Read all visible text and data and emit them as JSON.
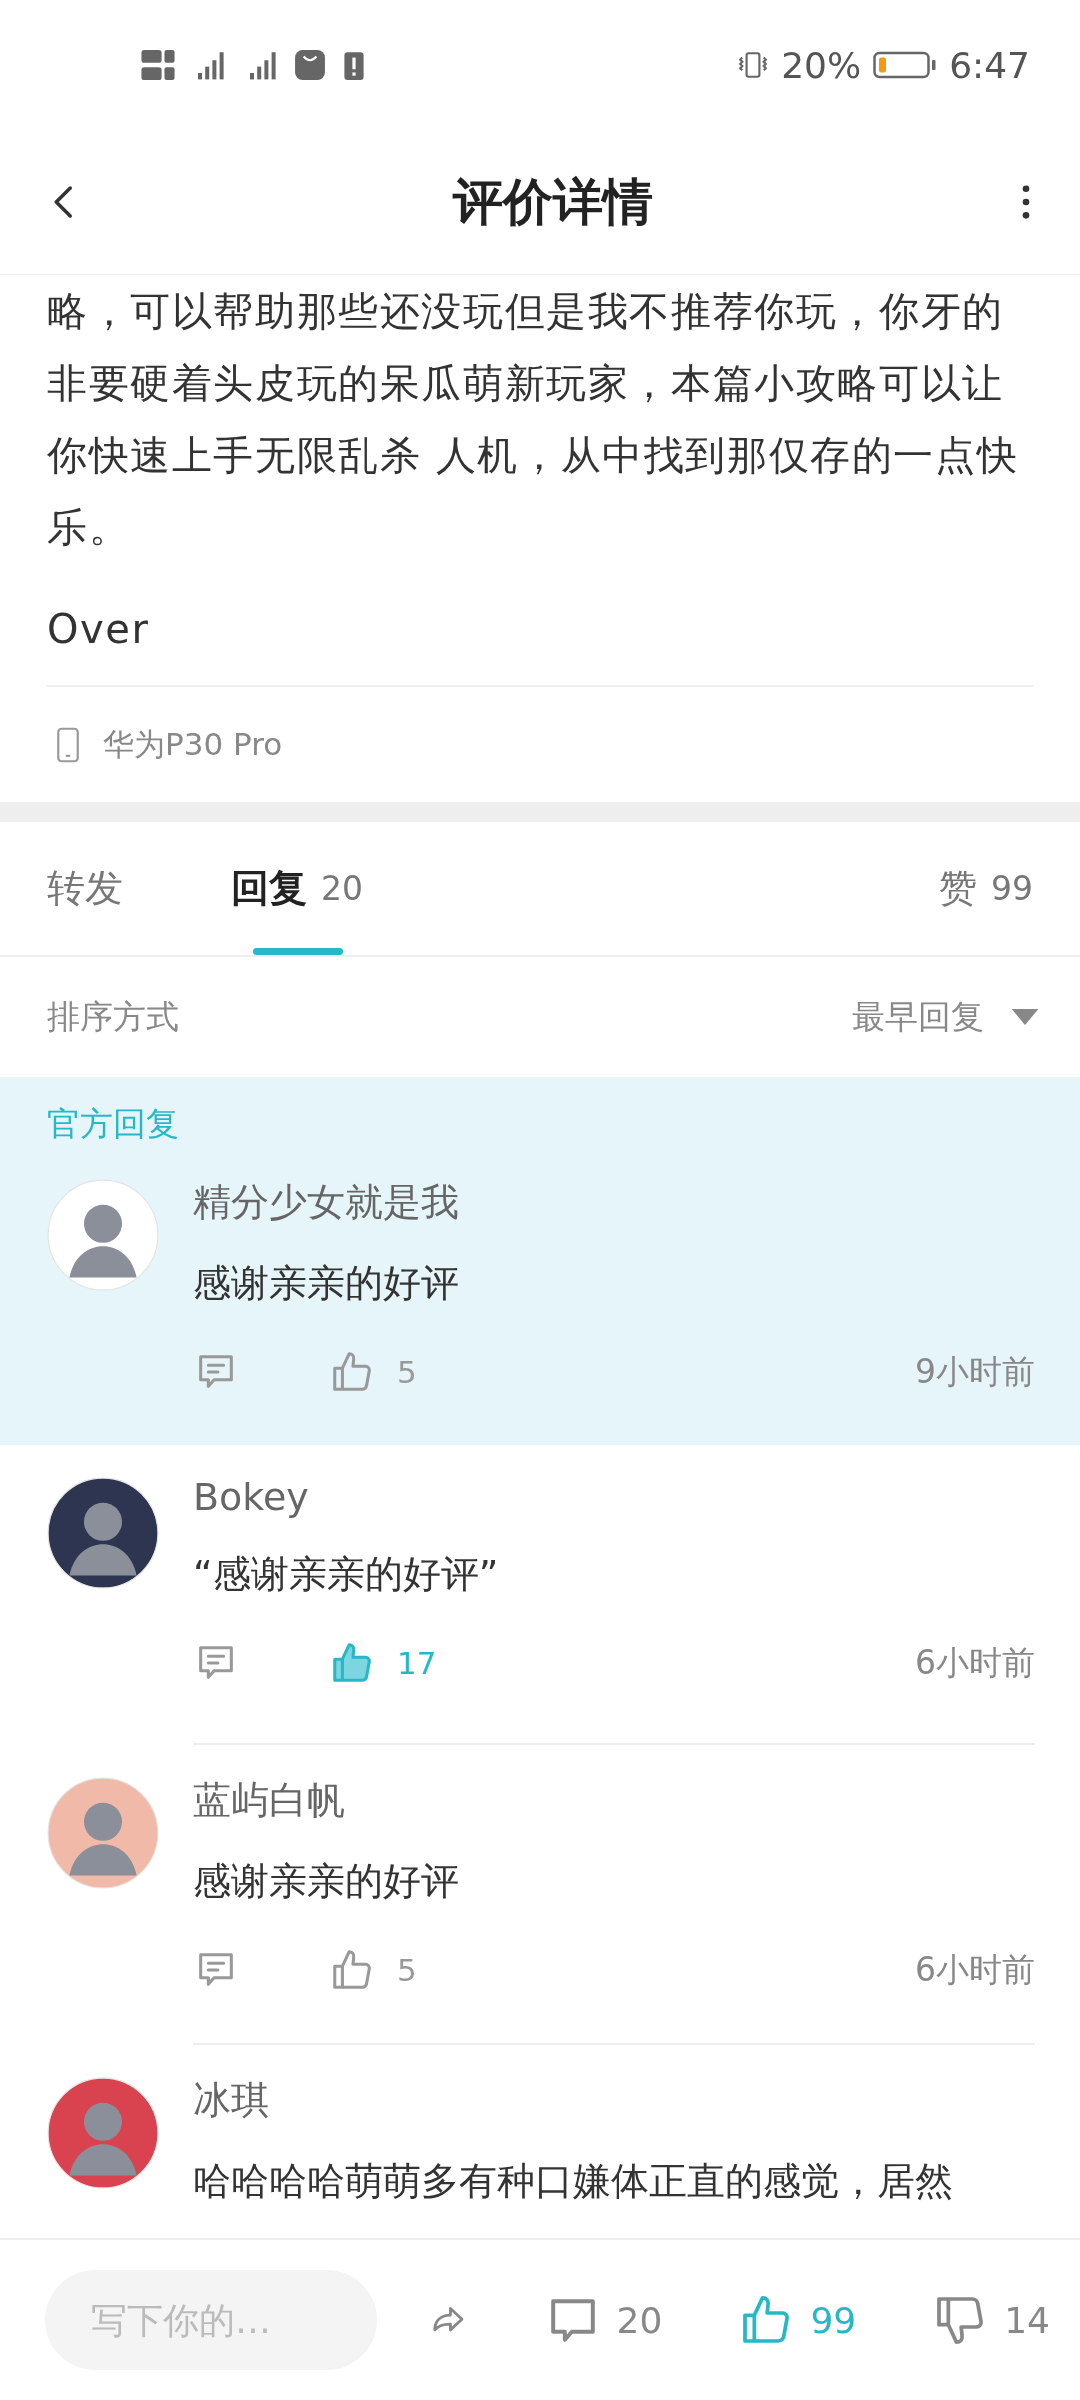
{
  "status_bar": {
    "battery": "20%",
    "time": "6:47"
  },
  "header": {
    "title": "评价详情"
  },
  "review": {
    "paragraphs": [
      "略，可以帮助那些还没玩但是我不推荐你玩，你牙的非要硬着头皮玩的呆瓜萌新玩家，本篇小攻略可以让你快速上手无限乱杀 人机，从中找到那仅存的一点快乐。",
      "Over"
    ],
    "device": "华为P30 Pro"
  },
  "tabs": [
    {
      "label": "转发",
      "selected": false
    },
    {
      "label": "回复",
      "count": "20",
      "selected": true
    },
    {
      "label": "赞",
      "count": "99",
      "selected": false
    }
  ],
  "sort": {
    "label": "排序方式",
    "value": "最早回复"
  },
  "official": {
    "label": "官方回复",
    "comments": [
      {
        "name": "精分少女就是我",
        "text": "感谢亲亲的好评",
        "likes": "5",
        "liked": false,
        "time": "9小时前"
      }
    ]
  },
  "comments": [
    {
      "name": "Bokey",
      "text": "“感谢亲亲的好评”",
      "likes": "17",
      "liked": true,
      "time": "6小时前"
    },
    {
      "name": "蓝屿白帆",
      "text": "感谢亲亲的好评",
      "likes": "5",
      "liked": false,
      "time": "6小时前"
    },
    {
      "name": "冰琪",
      "text": "哈哈哈哈萌萌多有种口嫌体正直的感觉，居然"
    }
  ],
  "bottom_bar": {
    "placeholder": "写下你的…",
    "comments": "20",
    "likes": "99",
    "liked": true,
    "dislikes": "14"
  }
}
